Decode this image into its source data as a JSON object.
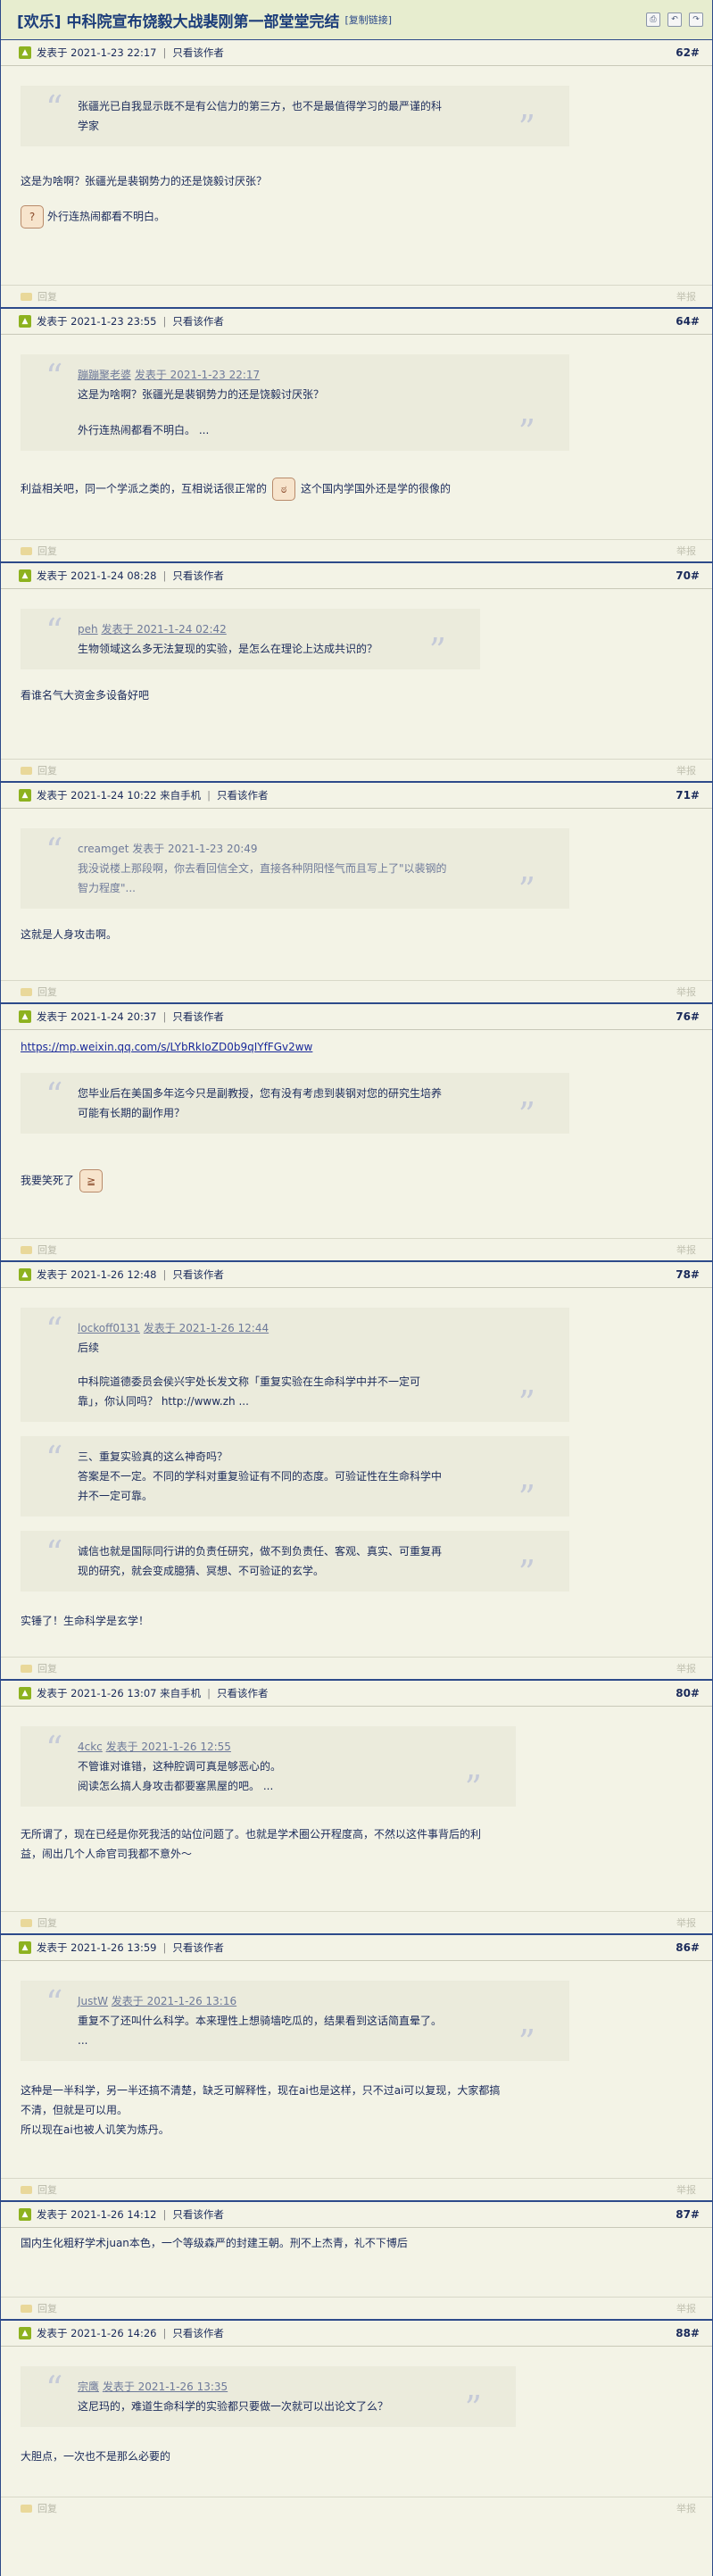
{
  "thread": {
    "title": "[欢乐] 中科院宣布饶毅大战裴刚第一部堂堂完结",
    "copy_link": "[复制链接]"
  },
  "labels": {
    "posted_at_prefix": "发表于",
    "only_author": "只看该作者",
    "reply": "回复",
    "tip": "举报",
    "mobile": "来自手机"
  },
  "posts": [
    {
      "time": "2021-1-23 22:17",
      "floor": "62#",
      "quote": {
        "lines": [
          "张疆光已自我显示既不是有公信力的第三方，也不是最值得学习的最严谨的科",
          "学家"
        ]
      },
      "paragraphs": [
        "这是为啥啊？张疆光是裴钢势力的还是饶毅讨厌张？",
        "外行连热闹都看不明白。"
      ]
    },
    {
      "time": "2021-1-23 23:55",
      "floor": "64#",
      "quote": {
        "author": "蹦蹦聚老婆",
        "quote_time": "发表于 2021-1-23 22:17",
        "lines": [
          "这是为啥啊？张疆光是裴钢势力的还是饶毅讨厌张？",
          "外行连热闹都看不明白。 ..."
        ]
      },
      "paragraphs": [
        "利益相关吧，同一个学派之类的，互相说话很正常的",
        "这个国内学国外还是学的很像的"
      ]
    },
    {
      "time": "2021-1-24 08:28",
      "floor": "70#",
      "quote": {
        "author": "peh",
        "quote_time": "发表于 2021-1-24 02:42",
        "lines": [
          "生物领域这么多无法复现的实验，是怎么在理论上达成共识的？"
        ]
      },
      "paragraphs": [
        "看谁名气大资金多设备好吧"
      ]
    },
    {
      "time": "2021-1-24 10:22",
      "mobile": true,
      "floor": "71#",
      "quote": {
        "author": "creamget",
        "quote_time": "发表于 2021-1-23 20:49",
        "lines": [
          "我没说楼上那段啊，你去看回信全文，直接各种阴阳怪气而且写上了\"以裴钢的",
          "智力程度\"..."
        ],
        "dim": true
      },
      "paragraphs": [
        "这就是人身攻击啊。"
      ]
    },
    {
      "time": "2021-1-24 20:37",
      "floor": "76#",
      "link": "https://mp.weixin.qq.com/s/LYbRkIoZD0b9qIYfFGv2ww",
      "quote": {
        "lines": [
          "您毕业后在美国多年迄今只是副教授，您有没有考虑到裴钢对您的研究生培养",
          "可能有长期的副作用？"
        ]
      },
      "paragraphs": [
        "我要笑死了"
      ]
    },
    {
      "time": "2021-1-26 12:48",
      "floor": "78#",
      "quotes": [
        {
          "author": "lockoff0131",
          "quote_time": "发表于 2021-1-26 12:44",
          "lines": [
            "后续",
            "",
            "中科院道德委员会侯兴宇处长发文称「重复实验在生命科学中并不一定可",
            "靠」，你认同吗？ http://www.zh ..."
          ]
        },
        {
          "lines": [
            "三、重复实验真的这么神奇吗？",
            "答案是不一定。不同的学科对重复验证有不同的态度。可验证性在生命科学中",
            "并不一定可靠。"
          ]
        },
        {
          "lines": [
            "诚信也就是国际同行讲的负责任研究，做不到负责任、客观、真实、可重复再",
            "现的研究，就会变成臆猜、冥想、不可验证的玄学。"
          ]
        }
      ],
      "paragraphs": [
        "实锤了！生命科学是玄学！"
      ]
    },
    {
      "time": "2021-1-26 13:07",
      "mobile": true,
      "floor": "80#",
      "quote": {
        "author": "4ckc",
        "quote_time": "发表于 2021-1-26 12:55",
        "lines": [
          "不管谁对谁错，这种腔调可真是够恶心的。",
          "阅读怎么搞人身攻击都要塞黑屋的吧。 ..."
        ]
      },
      "paragraphs": [
        "无所谓了，现在已经是你死我活的站位问题了。也就是学术圈公开程度高，不然以这件事背后的利",
        "益，闹出几个人命官司我都不意外～"
      ]
    },
    {
      "time": "2021-1-26 13:59",
      "floor": "86#",
      "quote": {
        "author": "JustW",
        "quote_time": "发表于 2021-1-26 13:16",
        "lines": [
          "重复不了还叫什么科学。本来理性上想骑墙吃瓜的，结果看到这话简直晕了。",
          "..."
        ]
      },
      "paragraphs": [
        "这种是一半科学，另一半还搞不清楚，缺乏可解释性，现在ai也是这样，只不过ai可以复现，大家都搞",
        "不清，但就是可以用。",
        "所以现在ai也被人讥笑为炼丹。"
      ]
    },
    {
      "time": "2021-1-26 14:12",
      "floor": "87#",
      "paragraphs": [
        "国内生化粗籽学术juan本色，一个等级森严的封建王朝。刑不上杰青，礼不下博后"
      ]
    },
    {
      "time": "2021-1-26 14:26",
      "floor": "88#",
      "quote": {
        "author": "宗鹰",
        "quote_time": "发表于 2021-1-26 13:35",
        "lines": [
          "这尼玛的，难道生命科学的实验都只要做一次就可以出论文了么？"
        ]
      },
      "paragraphs": [
        "大胆点，一次也不是那么必要的"
      ]
    }
  ]
}
